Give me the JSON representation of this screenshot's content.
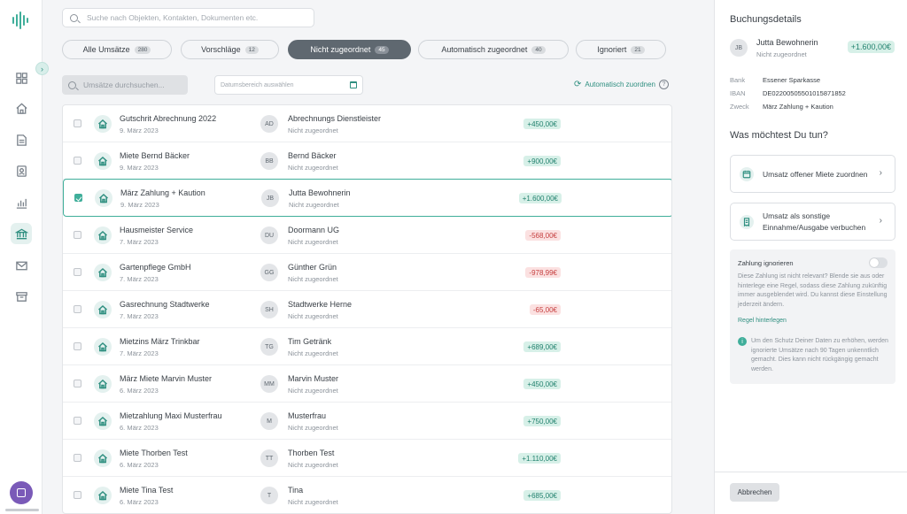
{
  "nav": {
    "items": [
      {
        "name": "dashboard",
        "active": false
      },
      {
        "name": "home",
        "active": false
      },
      {
        "name": "documents",
        "active": false
      },
      {
        "name": "contacts",
        "active": false
      },
      {
        "name": "reports",
        "active": false
      },
      {
        "name": "bank",
        "active": true
      },
      {
        "name": "mail",
        "active": false
      },
      {
        "name": "archive",
        "active": false
      }
    ],
    "collapse_glyph": "›"
  },
  "search": {
    "placeholder": "Suche nach Objekten, Kontakten, Dokumenten etc."
  },
  "tabs": [
    {
      "label": "Alle Umsätze",
      "count": "280",
      "active": false
    },
    {
      "label": "Vorschläge",
      "count": "12",
      "active": false
    },
    {
      "label": "Nicht zugeordnet",
      "count": "45",
      "active": true
    },
    {
      "label": "Automatisch zugeordnet",
      "count": "40",
      "active": false
    },
    {
      "label": "Ignoriert",
      "count": "21",
      "active": false
    }
  ],
  "filters": {
    "search_placeholder": "Umsätze durchsuchen...",
    "date_placeholder": "Datumsbereich auswählen",
    "auto_assign_label": "Automatisch zuordnen",
    "help_glyph": "?"
  },
  "transactions": [
    {
      "title": "Gutschrit Abrechnung 2022",
      "date": "9. März 2023",
      "initials": "AD",
      "contact": "Abrechnungs Dienstleister",
      "status": "Nicht zugeordnet",
      "amount": "+450,00€",
      "positive": true,
      "selected": false
    },
    {
      "title": "Miete Bernd Bäcker",
      "date": "9. März 2023",
      "initials": "BB",
      "contact": "Bernd Bäcker",
      "status": "Nicht zugeordnet",
      "amount": "+900,00€",
      "positive": true,
      "selected": false
    },
    {
      "title": "März Zahlung + Kaution",
      "date": "9. März 2023",
      "initials": "JB",
      "contact": "Jutta Bewohnerin",
      "status": "Nicht zugeordnet",
      "amount": "+1.600,00€",
      "positive": true,
      "selected": true
    },
    {
      "title": "Hausmeister Service",
      "date": "7. März 2023",
      "initials": "DU",
      "contact": "Doormann UG",
      "status": "Nicht zugeordnet",
      "amount": "-568,00€",
      "positive": false,
      "selected": false
    },
    {
      "title": "Gartenpflege GmbH",
      "date": "7. März 2023",
      "initials": "GG",
      "contact": "Günther Grün",
      "status": "Nicht zugeordnet",
      "amount": "-978,99€",
      "positive": false,
      "selected": false
    },
    {
      "title": "Gasrechnung Stadtwerke",
      "date": "7. März 2023",
      "initials": "SH",
      "contact": "Stadtwerke Herne",
      "status": "Nicht zugeordnet",
      "amount": "-65,00€",
      "positive": false,
      "selected": false
    },
    {
      "title": "Mietzins März Trinkbar",
      "date": "7. März 2023",
      "initials": "TG",
      "contact": "Tim Getränk",
      "status": "Nicht zugeordnet",
      "amount": "+689,00€",
      "positive": true,
      "selected": false
    },
    {
      "title": "März Miete Marvin Muster",
      "date": "6. März 2023",
      "initials": "MM",
      "contact": "Marvin Muster",
      "status": "Nicht zugeordnet",
      "amount": "+450,00€",
      "positive": true,
      "selected": false
    },
    {
      "title": "Mietzahlung Maxi Musterfrau",
      "date": "6. März 2023",
      "initials": "M",
      "contact": "Musterfrau",
      "status": "Nicht zugeordnet",
      "amount": "+750,00€",
      "positive": true,
      "selected": false
    },
    {
      "title": "Miete Thorben Test",
      "date": "6. März 2023",
      "initials": "TT",
      "contact": "Thorben Test",
      "status": "Nicht zugeordnet",
      "amount": "+1.110,00€",
      "positive": true,
      "selected": false
    },
    {
      "title": "Miete Tina Test",
      "date": "6. März 2023",
      "initials": "T",
      "contact": "Tina",
      "status": "Nicht zugeordnet",
      "amount": "+685,00€",
      "positive": true,
      "selected": false
    }
  ],
  "panel": {
    "title": "Buchungsdetails",
    "initials": "JB",
    "name": "Jutta Bewohnerin",
    "status": "Nicht zugeordnet",
    "amount": "+1.600,00€",
    "details": [
      {
        "key": "Bank",
        "value": "Essener Sparkasse"
      },
      {
        "key": "IBAN",
        "value": "DE02200505501015871852"
      },
      {
        "key": "Zweck",
        "value": "März Zahlung + Kaution"
      }
    ],
    "question": "Was möchtest Du tun?",
    "action_1": "Umsatz offener Miete zuordnen",
    "action_2_line1": "Umsatz als sonstige",
    "action_2_line2": "Einnahme/Ausgabe verbuchen",
    "chevron": "›",
    "ignore_title": "Zahlung ignorieren",
    "ignore_desc": "Diese Zahlung ist nicht relevant? Blende sie aus oder hinterlege eine Regel, sodass diese Zahlung zukünftig immer ausgeblendet wird. Du kannst diese Einstellung jederzeit ändern.",
    "ignore_link": "Regel hinterlegen",
    "info_glyph": "i",
    "info_note": "Um den Schutz Deiner Daten zu erhöhen, werden ignorierte Umsätze nach 90 Tagen unkenntlich gemacht. Dies kann nicht rückgängig gemacht werden.",
    "cancel_label": "Abbrechen"
  },
  "colors": {
    "accent": "#3fae9a",
    "positive_bg": "#d7f0e8",
    "negative_bg": "#fbe1e1"
  }
}
